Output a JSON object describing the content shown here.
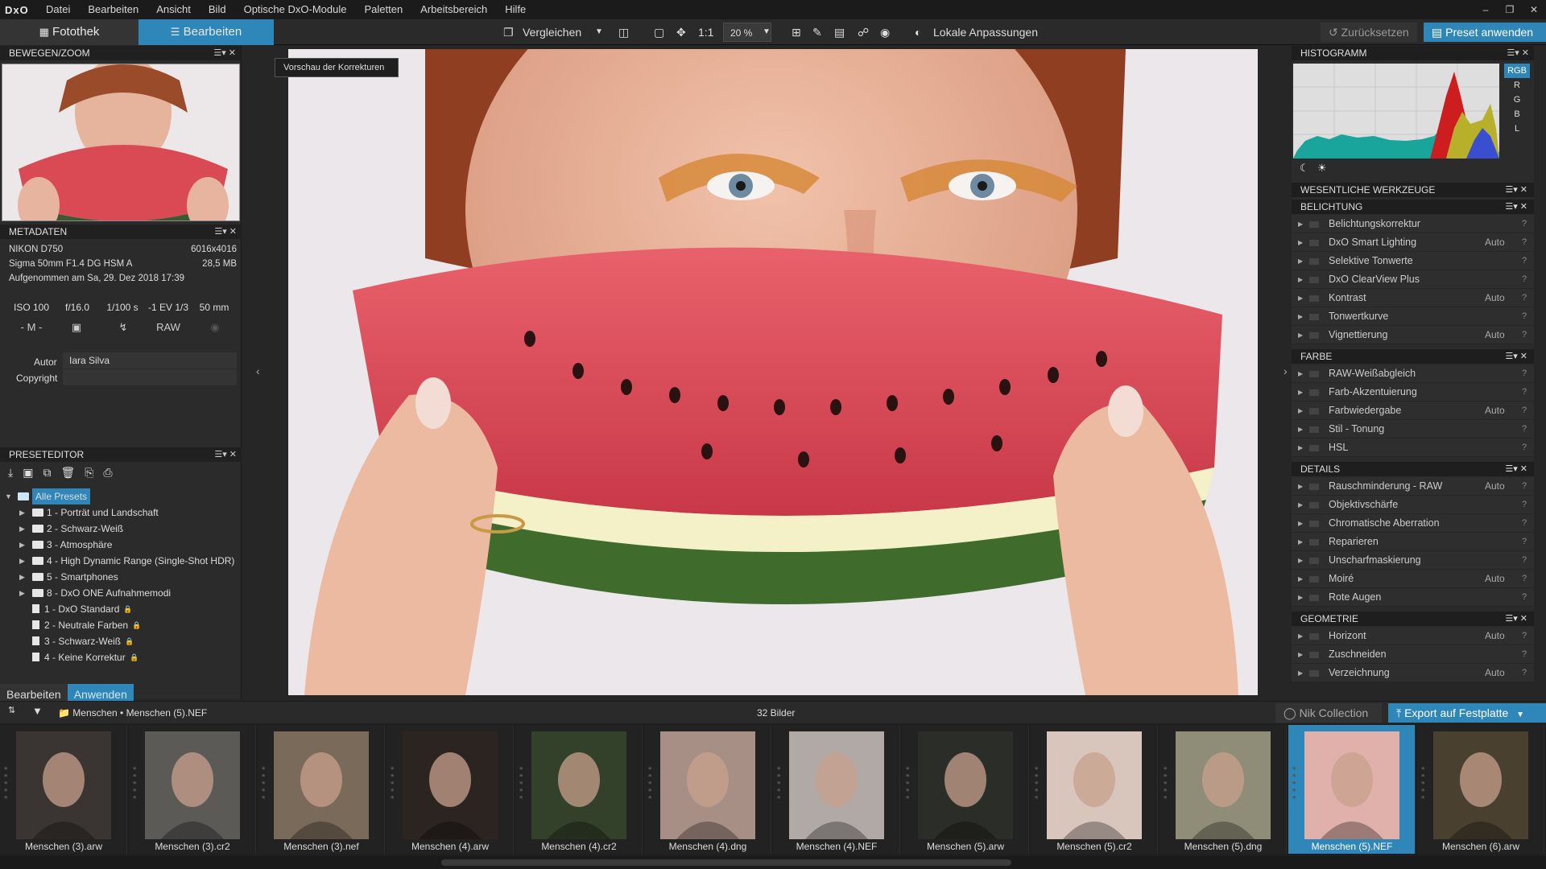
{
  "menu": {
    "logo": "DxO",
    "items": [
      "Datei",
      "Bearbeiten",
      "Ansicht",
      "Bild",
      "Optische DxO-Module",
      "Paletten",
      "Arbeitsbereich",
      "Hilfe"
    ]
  },
  "toolbar": {
    "tab_library": "Fotothek",
    "tab_edit": "Bearbeiten",
    "compare": "Vergleichen",
    "one_to_one": "1:1",
    "zoom": "20 %",
    "local_adjust": "Lokale Anpassungen",
    "reset": "Zurücksetzen",
    "apply_preset": "Preset anwenden"
  },
  "left": {
    "nav_title": "BEWEGEN/ZOOM",
    "meta_title": "METADATEN",
    "camera": "NIKON D750",
    "resolution": "6016x4016",
    "lens": "Sigma 50mm F1.4 DG HSM A",
    "filesize": "28,5 MB",
    "taken": "Aufgenommen am Sa, 29. Dez 2018 17:39",
    "iso": "ISO 100",
    "aperture": "f/16.0",
    "shutter": "1/100 s",
    "ev": "-1 EV 1/3",
    "focal": "50 mm",
    "mode": "- M -",
    "format": "RAW",
    "author_label": "Autor",
    "author_value": "Iara Silva",
    "copyright_label": "Copyright",
    "copyright_value": "",
    "preset_title": "PRESETEDITOR",
    "tree": [
      {
        "label": "Alle Presets",
        "kind": "root"
      },
      {
        "label": "1 - Porträt und Landschaft",
        "kind": "folder"
      },
      {
        "label": "2 - Schwarz-Weiß",
        "kind": "folder"
      },
      {
        "label": "3 - Atmosphäre",
        "kind": "folder"
      },
      {
        "label": "4 - High Dynamic Range (Single-Shot HDR)",
        "kind": "folder"
      },
      {
        "label": "5 - Smartphones",
        "kind": "folder"
      },
      {
        "label": "8 - DxO ONE Aufnahmemodi",
        "kind": "folder"
      },
      {
        "label": "1 - DxO Standard",
        "kind": "preset"
      },
      {
        "label": "2 - Neutrale Farben",
        "kind": "preset"
      },
      {
        "label": "3 - Schwarz-Weiß",
        "kind": "preset"
      },
      {
        "label": "4 - Keine Korrektur",
        "kind": "preset"
      }
    ],
    "tab_edit": "Bearbeiten",
    "tab_apply": "Anwenden"
  },
  "viewer": {
    "tooltip": "Vorschau der Korrekturen"
  },
  "right": {
    "histo_title": "HISTOGRAMM",
    "channels": [
      "RGB",
      "R",
      "G",
      "B",
      "L"
    ],
    "essential_title": "WESENTLICHE WERKZEUGE",
    "sections": [
      {
        "title": "BELICHTUNG",
        "tools": [
          {
            "name": "Belichtungskorrektur",
            "auto": ""
          },
          {
            "name": "DxO Smart Lighting",
            "auto": "Auto"
          },
          {
            "name": "Selektive Tonwerte",
            "auto": ""
          },
          {
            "name": "DxO ClearView Plus",
            "auto": ""
          },
          {
            "name": "Kontrast",
            "auto": "Auto"
          },
          {
            "name": "Tonwertkurve",
            "auto": ""
          },
          {
            "name": "Vignettierung",
            "auto": "Auto"
          }
        ]
      },
      {
        "title": "FARBE",
        "tools": [
          {
            "name": "RAW-Weißabgleich",
            "auto": ""
          },
          {
            "name": "Farb-Akzentuierung",
            "auto": ""
          },
          {
            "name": "Farbwiedergabe",
            "auto": "Auto"
          },
          {
            "name": "Stil - Tonung",
            "auto": ""
          },
          {
            "name": "HSL",
            "auto": ""
          }
        ]
      },
      {
        "title": "DETAILS",
        "tools": [
          {
            "name": "Rauschminderung - RAW",
            "auto": "Auto"
          },
          {
            "name": "Objektivschärfe",
            "auto": ""
          },
          {
            "name": "Chromatische Aberration",
            "auto": ""
          },
          {
            "name": "Reparieren",
            "auto": ""
          },
          {
            "name": "Unscharfmaskierung",
            "auto": ""
          },
          {
            "name": "Moiré",
            "auto": "Auto"
          },
          {
            "name": "Rote Augen",
            "auto": ""
          }
        ]
      },
      {
        "title": "GEOMETRIE",
        "tools": [
          {
            "name": "Horizont",
            "auto": "Auto"
          },
          {
            "name": "Zuschneiden",
            "auto": ""
          },
          {
            "name": "Verzeichnung",
            "auto": "Auto"
          }
        ]
      }
    ]
  },
  "filmstrip": {
    "path_folder": "Menschen",
    "path_file": "Menschen (5).NEF",
    "count": "32 Bilder",
    "nik": "Nik Collection",
    "export": "Export auf Festplatte",
    "items": [
      {
        "label": "Menschen (3).arw",
        "selected": false,
        "tone": "#3a3532"
      },
      {
        "label": "Menschen (3).cr2",
        "selected": false,
        "tone": "#5b5a57"
      },
      {
        "label": "Menschen (3).nef",
        "selected": false,
        "tone": "#7a6a5a"
      },
      {
        "label": "Menschen (4).arw",
        "selected": false,
        "tone": "#2c2420"
      },
      {
        "label": "Menschen (4).cr2",
        "selected": false,
        "tone": "#33402a"
      },
      {
        "label": "Menschen (4).dng",
        "selected": false,
        "tone": "#a88f86"
      },
      {
        "label": "Menschen (4).NEF",
        "selected": false,
        "tone": "#b0a9a6"
      },
      {
        "label": "Menschen (5).arw",
        "selected": false,
        "tone": "#2b2d28"
      },
      {
        "label": "Menschen (5).cr2",
        "selected": false,
        "tone": "#d8c6bd"
      },
      {
        "label": "Menschen (5).dng",
        "selected": false,
        "tone": "#8f8d77"
      },
      {
        "label": "Menschen (5).NEF",
        "selected": true,
        "tone": "#e0b0aa"
      },
      {
        "label": "Menschen (6).arw",
        "selected": false,
        "tone": "#4a4030"
      }
    ]
  }
}
